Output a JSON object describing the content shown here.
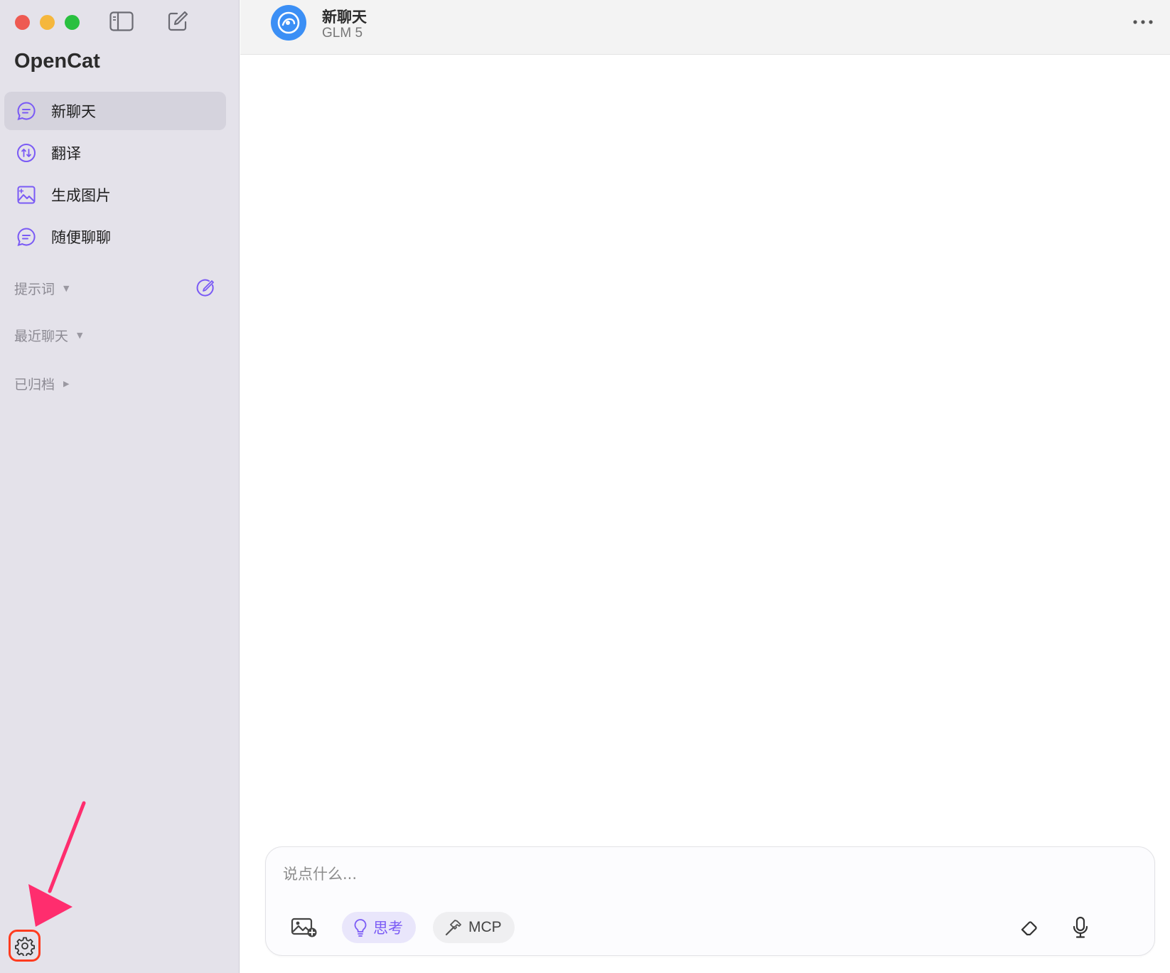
{
  "sidebar": {
    "app_title": "OpenCat",
    "nav_items": [
      {
        "label": "新聊天",
        "icon": "chat-bubble-icon",
        "active": true
      },
      {
        "label": "翻译",
        "icon": "translate-icon",
        "active": false
      },
      {
        "label": "生成图片",
        "icon": "image-generate-icon",
        "active": false
      },
      {
        "label": "随便聊聊",
        "icon": "chat-bubble-icon",
        "active": false
      }
    ],
    "sections": [
      {
        "title": "提示词",
        "caret": "▼"
      },
      {
        "title": "最近聊天",
        "caret": "▼"
      },
      {
        "title": "已归档",
        "caret": "▶"
      }
    ]
  },
  "header": {
    "title": "新聊天",
    "model": "GLM 5"
  },
  "composer": {
    "placeholder": "说点什么...",
    "think_label": "思考",
    "mcp_label": "MCP"
  },
  "colors": {
    "accent": "#7a5af5",
    "sidebar_bg": "#e4e2ea",
    "avatar": "#3b8ff5",
    "highlight": "#ff3b1f",
    "arrow": "#ff2d6e"
  }
}
